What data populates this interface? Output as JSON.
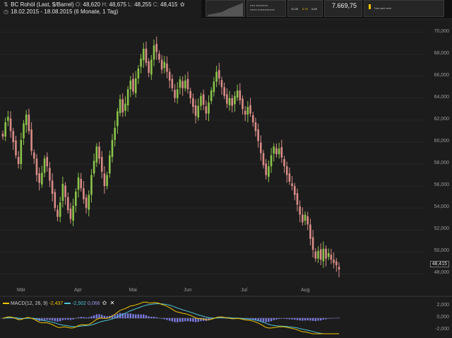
{
  "header": {
    "instrument": "BC Rohöl (Last, $/Barrel)",
    "open_label": "O:",
    "open": "48,620",
    "high_label": "H:",
    "high": "48,675",
    "low_label": "L:",
    "low": "48,255",
    "close_label": "C:",
    "close": "48,415",
    "date_range": "18.02.2015 - 18.08.2015 (6 Monate, 1 Tag)"
  },
  "widgets": {
    "w2_line1": "●●● ●●●●●●●",
    "w2_line2": "●●●● ●●●●●●●●●●",
    "w3_vals": [
      "12,35",
      "0,75",
      "5,68"
    ],
    "w4_big": "7.669,75",
    "w5_text": "Das wird sehr"
  },
  "colors": {
    "background": "#1c1c1c",
    "up": "#8bc34a",
    "down": "#d98c87",
    "macd_line": "#f2c400",
    "signal_line": "#4fc3d9",
    "histogram": "#7a7ae0"
  },
  "chart_data": {
    "type": "candlestick",
    "title": "BC Rohöl (Last, $/Barrel)",
    "ylim": [
      47,
      71
    ],
    "y_ticks": [
      "48,000",
      "50,000",
      "52,000",
      "54,000",
      "56,000",
      "58,000",
      "60,000",
      "62,000",
      "64,000",
      "66,000",
      "68,000",
      "70,000"
    ],
    "x_ticks": [
      "Mär",
      "Apr",
      "Mai",
      "Jun",
      "Jul",
      "Aug"
    ],
    "last_price": "48,415",
    "close_approx": [
      60.5,
      61.8,
      62.3,
      61.0,
      60.0,
      58.8,
      58.0,
      60.2,
      61.7,
      62.5,
      61.0,
      59.2,
      58.5,
      57.0,
      56.3,
      57.2,
      58.5,
      57.8,
      56.5,
      55.3,
      54.0,
      53.2,
      54.5,
      56.2,
      55.0,
      53.8,
      53.0,
      54.2,
      55.5,
      56.8,
      55.8,
      54.8,
      54.0,
      55.2,
      57.0,
      58.3,
      59.6,
      58.5,
      57.3,
      56.0,
      57.0,
      58.8,
      60.2,
      61.3,
      62.8,
      63.9,
      62.7,
      63.5,
      64.8,
      65.6,
      64.6,
      65.8,
      66.7,
      67.6,
      68.5,
      67.2,
      66.3,
      67.5,
      68.8,
      68.2,
      67.5,
      66.6,
      67.3,
      66.4,
      65.6,
      64.9,
      64.0,
      64.8,
      65.7,
      64.9,
      65.6,
      64.8,
      64.0,
      63.2,
      62.4,
      63.3,
      64.2,
      63.4,
      62.6,
      63.6,
      64.7,
      65.5,
      66.4,
      65.8,
      65.0,
      64.2,
      63.5,
      64.0,
      63.3,
      64.2,
      64.7,
      63.8,
      63.0,
      62.5,
      63.2,
      62.6,
      61.8,
      61.0,
      60.1,
      59.0,
      57.9,
      57.0,
      57.8,
      58.8,
      59.6,
      58.9,
      59.4,
      58.6,
      57.8,
      57.0,
      56.4,
      56.0,
      55.2,
      54.3,
      53.4,
      52.7,
      53.4,
      52.5,
      51.2,
      50.2,
      49.4,
      50.1,
      49.3,
      50.3,
      49.4,
      49.9,
      49.3,
      49.0,
      48.8,
      48.4
    ],
    "macd": {
      "label": "MACD(12, 26, 9)",
      "macd_value": "-2,437",
      "signal_value": "-2,502",
      "hist_value": "0,066",
      "y_ticks": [
        "2,000",
        "0,000",
        "-2,000"
      ],
      "ylim": [
        -2.6,
        2.6
      ]
    }
  }
}
